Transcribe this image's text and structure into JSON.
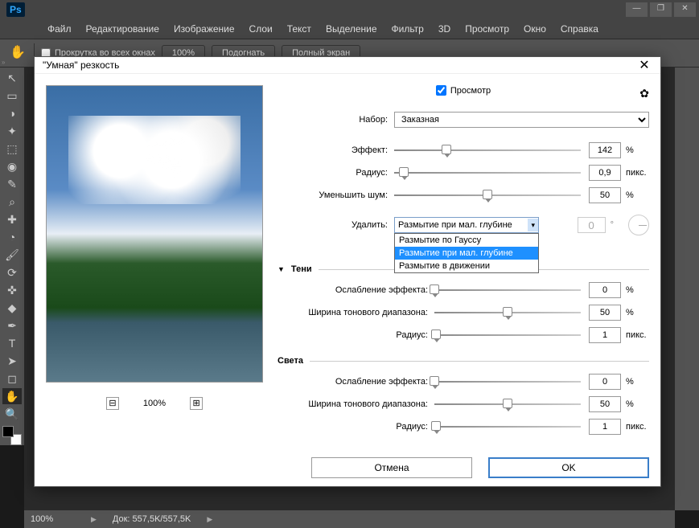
{
  "app": {
    "logo": "Ps"
  },
  "window_controls": {
    "min": "—",
    "restore": "❐",
    "close": "✕"
  },
  "menu": [
    "Файл",
    "Редактирование",
    "Изображение",
    "Слои",
    "Текст",
    "Выделение",
    "Фильтр",
    "3D",
    "Просмотр",
    "Окно",
    "Справка"
  ],
  "options": {
    "tool_glyph": "✋",
    "scroll_all_label": "Прокрутка во всех окнах",
    "zoom100": "100%",
    "fit": "Подогнать",
    "fullscreen": "Полный экран"
  },
  "tools": [
    "↖",
    "▭",
    "◑",
    "✦",
    "⬚",
    "◉",
    "✎",
    "⌕",
    "✚",
    "◔",
    "🖌",
    "⟳",
    "✜",
    "◆",
    "✒",
    "T",
    "➤",
    "✋",
    "🔍"
  ],
  "statusbar": {
    "zoom": "100%",
    "doc_label": "Док:",
    "doc_size": "557,5K/557,5K"
  },
  "dialog": {
    "title": "\"Умная\" резкость",
    "close": "✕",
    "preview_label": "Просмотр",
    "preset_label": "Набор:",
    "preset_value": "Заказная",
    "amount_label": "Эффект:",
    "amount_value": "142",
    "amount_unit": "%",
    "radius_label": "Радиус:",
    "radius_value": "0,9",
    "radius_unit": "пикс.",
    "noise_label": "Уменьшить шум:",
    "noise_value": "50",
    "noise_unit": "%",
    "remove_label": "Удалить:",
    "remove_value": "Размытие при мал. глубине",
    "remove_options": [
      "Размытие по Гауссу",
      "Размытие при мал. глубине",
      "Размытие в движении"
    ],
    "angle_value": "0",
    "shadows_title": "Тени",
    "highlights_title": "Света",
    "fade_label": "Ослабление эффекта:",
    "tonal_label": "Ширина тонового диапазона:",
    "sec_radius_label": "Радиус:",
    "shadows": {
      "fade": "0",
      "tonal": "50",
      "radius": "1"
    },
    "highlights": {
      "fade": "0",
      "tonal": "50",
      "radius": "1"
    },
    "pct": "%",
    "px": "пикс.",
    "zoom_val": "100%",
    "cancel": "Отмена",
    "ok": "OK",
    "gear": "✿",
    "minus": "⊟",
    "plus": "⊞"
  }
}
